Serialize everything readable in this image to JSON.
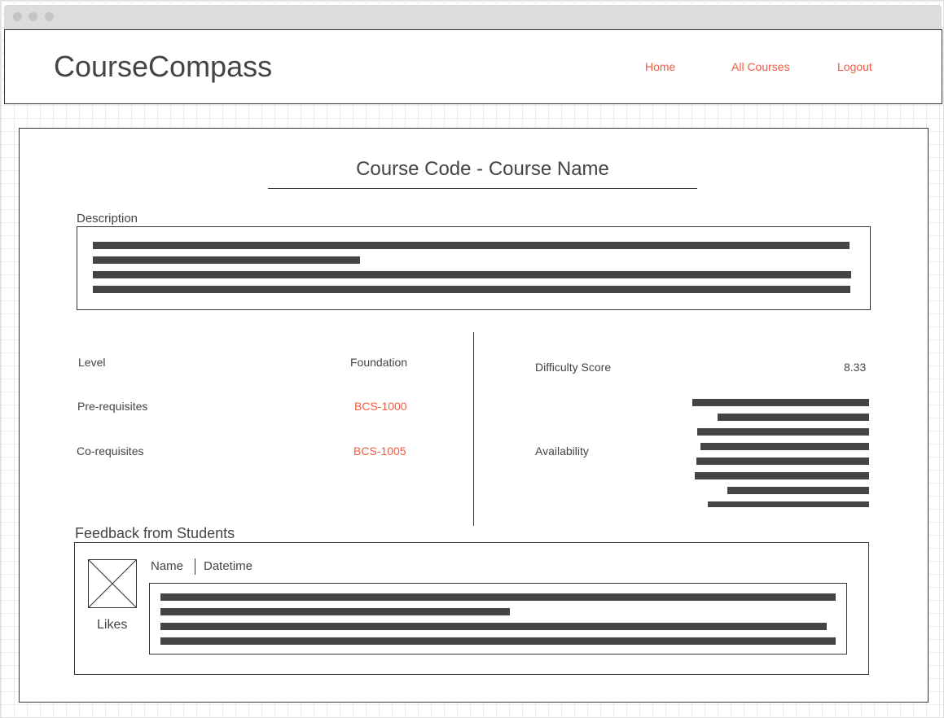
{
  "app": {
    "brand": "CourseCompass",
    "nav": [
      "Home",
      "All Courses",
      "Logout"
    ]
  },
  "course": {
    "title": "Course Code - Course Name",
    "description_label": "Description",
    "level_label": "Level",
    "level_value": "Foundation",
    "prereq_label": "Pre-requisites",
    "prereq_value": "BCS-1000",
    "coreq_label": "Co-requisites",
    "coreq_value": "BCS-1005",
    "difficulty_label": "Difficulty Score",
    "difficulty_value": "8.33",
    "availability_label": "Availability"
  },
  "feedback": {
    "section_label": "Feedback from Students",
    "name": "Name",
    "datetime": "Datetime",
    "likes": "Likes"
  },
  "colors": {
    "accent": "#f25c3f",
    "text": "#444444",
    "border": "#333333",
    "placeholder_bar": "#444444"
  }
}
